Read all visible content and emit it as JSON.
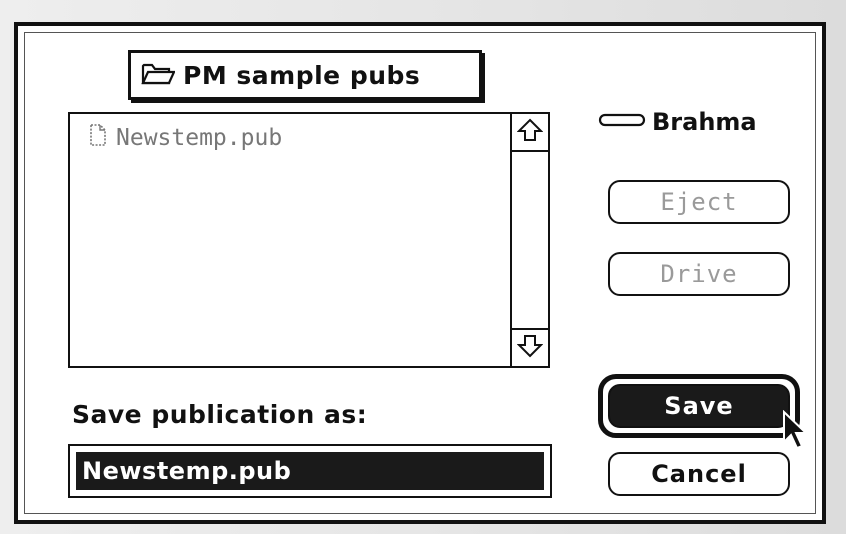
{
  "dialog": {
    "folder_popup": {
      "label": "PM sample pubs",
      "icon": "open-folder-icon"
    },
    "file_list": {
      "items": [
        {
          "name": "Newstemp.pub",
          "icon": "document-icon",
          "dimmed": true
        }
      ],
      "scroll_up_icon": "up-arrow-icon",
      "scroll_down_icon": "down-arrow-icon"
    },
    "drive": {
      "name": "Brahma",
      "icon": "drive-icon"
    },
    "buttons": {
      "eject": "Eject",
      "drive": "Drive",
      "save": "Save",
      "cancel": "Cancel"
    },
    "save_as_label": "Save publication as:",
    "filename_value": "Newstemp.pub"
  },
  "colors": {
    "frame": "#111111",
    "selection": "#1a1a1a",
    "disabled_text": "#9a9a9a"
  }
}
